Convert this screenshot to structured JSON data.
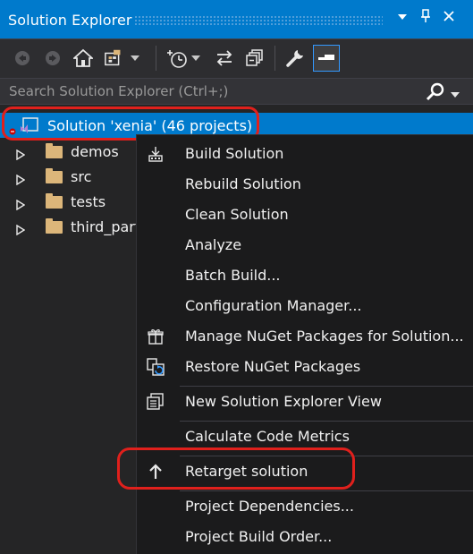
{
  "window": {
    "title": "Solution Explorer",
    "dropdown_icon": "dropdown-arrow-icon",
    "pin_icon": "pin-icon",
    "close_icon": "close-icon"
  },
  "toolbar": {
    "items": [
      "back-icon",
      "forward-icon",
      "home-icon",
      "switch-views-icon",
      "history-icon",
      "sync-icon",
      "collapse-all-icon",
      "properties-wrench-icon",
      "preview-icon"
    ]
  },
  "search": {
    "placeholder": "Search Solution Explorer (Ctrl+;)"
  },
  "tree": {
    "root_label": "Solution 'xenia' (46 projects)",
    "folders": [
      {
        "label": "demos"
      },
      {
        "label": "src"
      },
      {
        "label": "tests"
      },
      {
        "label": "third_part"
      }
    ]
  },
  "context_menu": {
    "items": [
      {
        "label": "Build Solution",
        "icon": "build-icon"
      },
      {
        "label": "Rebuild Solution",
        "icon": ""
      },
      {
        "label": "Clean Solution",
        "icon": ""
      },
      {
        "label": "Analyze",
        "icon": ""
      },
      {
        "label": "Batch Build...",
        "icon": ""
      },
      {
        "label": "Configuration Manager...",
        "icon": ""
      },
      {
        "label": "Manage NuGet Packages for Solution...",
        "icon": "nuget-gift-icon"
      },
      {
        "label": "Restore NuGet Packages",
        "icon": "restore-icon"
      },
      {
        "label": "New Solution Explorer View",
        "icon": "new-view-icon"
      },
      {
        "label": "Calculate Code Metrics",
        "icon": ""
      },
      {
        "label": "Retarget solution",
        "icon": "up-arrow-icon"
      },
      {
        "label": "Project Dependencies...",
        "icon": ""
      },
      {
        "label": "Project Build Order...",
        "icon": ""
      }
    ]
  },
  "colors": {
    "accent": "#007acc",
    "annotation": "#e0201c",
    "background": "#252526",
    "menu_background": "#1b1b1c"
  }
}
